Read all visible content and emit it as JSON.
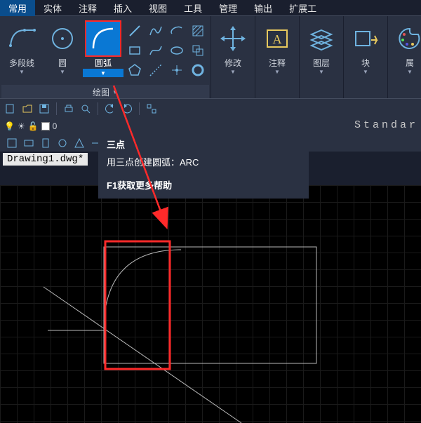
{
  "tabs": [
    "常用",
    "实体",
    "注释",
    "插入",
    "视图",
    "工具",
    "管理",
    "输出",
    "扩展工"
  ],
  "active_tab_index": 0,
  "panels": {
    "draw": {
      "polyline": "多段线",
      "circle": "圆",
      "arc": "圆弧",
      "title": "绘图"
    },
    "modify": "修改",
    "annotate": "注释",
    "layers": "图层",
    "block": "块",
    "props": "属"
  },
  "tooltip": {
    "title": "三点",
    "desc": "用三点创建圆弧：ARC",
    "help": "F1获取更多帮助"
  },
  "layerbar": {
    "zero": "0"
  },
  "doc_tab": "Drawing1.dwg*",
  "standard_text": "Standar",
  "annotation_red_color": "#ff2a2a"
}
